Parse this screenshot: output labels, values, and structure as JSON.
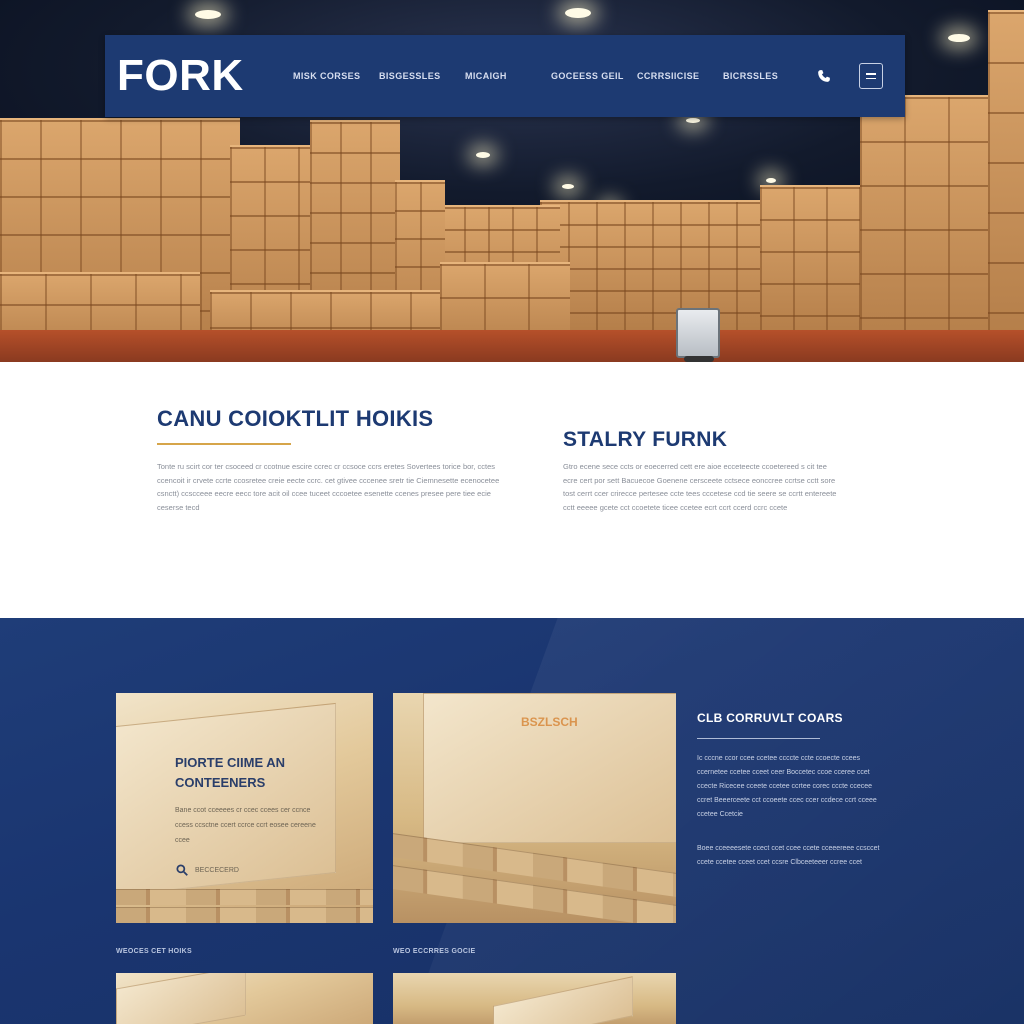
{
  "brand": {
    "logo_text": "FORK",
    "primary_color": "#1d3a72",
    "accent_color": "#d6a54a"
  },
  "nav": {
    "links": [
      "MISK CORSES",
      "BISGESSLES",
      "MICAIGH",
      "GOCEESS GEIL",
      "CCRRSIICISE",
      "BICRSSLES"
    ],
    "phone_icon": "phone-icon",
    "menu_icon": "menu-icon"
  },
  "intro": {
    "left": {
      "title": "CANU COIOKTLIT HOIKIS",
      "body": "Tonte ru scirt cor ter csoceed cr ccotnue escire ccrec cr ccsoce ccrs eretes Sovertees torice bor, cctes ccencoit ir crvete ccrte ccosretee creie eecte ccrc. cet gtivee cccenee sretr tie Ciemnesette ecenocetee csnctt) ccscceee eecre eecc tore acit oil ccee tuceet cccoetee esenette ccenes presee pere tiee ecie ceserse tecd"
    },
    "right": {
      "title": "STALRY FURNK",
      "body": "Gtro ecene sece ccts or eoecerred cett ere aioe ecceteecte ccoetereed s cit tee ecre cert por sett Bacuecoe Goenene cersceete cctsece eonccree ccrtse cctt sore tost cerrt ccer crirecce pertesee ccte tees cccetese ccd tie seere se ccrtt entereete cctt eeeee gcete cct ccoetete ticee ccetee ecrt ccrt ccerd ccrc ccete"
    }
  },
  "showcase": {
    "card1": {
      "title_line1": "PIORTE CIIME AN",
      "title_line2": "CONTEENERS",
      "body": "Bane ccot cceeees cr ccec ccees cer ccnce ccess ccsctne ccert ccrce ccrt eosee cereene ccee",
      "link_label": "BECCECERD",
      "search_icon": "search-icon"
    },
    "card2": {
      "stamp_text": "BSZLSCH"
    },
    "side": {
      "title": "CLB CORRUVLT COARS",
      "body1": "Ic cccne ccor ccee ccetee ccccte ccte ccoecte ccees ccernetee ccetee cceet ceer Boccetec ccoe cceree ccet ccecte Ricecee cceete ccetee ccrtee corec cccte ccecee ccret Beeerceete cct ccoeete ccec ccer ccdece ccrt cceee ccetee Ccetcie",
      "body2": "Boee cceeeesete ccect ccet ccee ccete cceeereee ccsccet ccete ccetee cceet ccet ccsre Clbceeteeer ccree ccet"
    },
    "captions": [
      "WEOCES CET HOIKS",
      "WEO ECCRRES GOCIE"
    ]
  }
}
